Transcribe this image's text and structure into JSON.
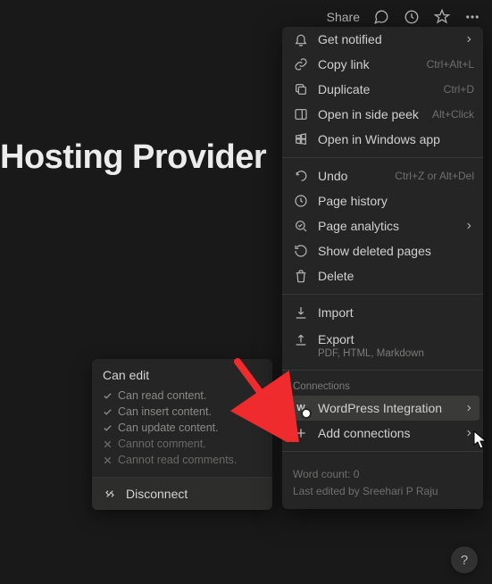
{
  "topbar": {
    "share_label": "Share"
  },
  "page": {
    "title": "Hosting Provider"
  },
  "permissions": {
    "header": "Can edit",
    "items": [
      {
        "label": "Can read content.",
        "allowed": true
      },
      {
        "label": "Can insert content.",
        "allowed": true
      },
      {
        "label": "Can update content.",
        "allowed": true
      },
      {
        "label": "Cannot comment.",
        "allowed": false
      },
      {
        "label": "Cannot read comments.",
        "allowed": false
      }
    ],
    "disconnect_label": "Disconnect"
  },
  "menu": {
    "items": [
      {
        "icon": "bell",
        "label": "Get notified",
        "chevron": true
      },
      {
        "icon": "link",
        "label": "Copy link",
        "shortcut": "Ctrl+Alt+L"
      },
      {
        "icon": "duplicate",
        "label": "Duplicate",
        "shortcut": "Ctrl+D"
      },
      {
        "icon": "sidepeek",
        "label": "Open in side peek",
        "shortcut": "Alt+Click"
      },
      {
        "icon": "windows",
        "label": "Open in Windows app"
      }
    ],
    "items2": [
      {
        "icon": "undo",
        "label": "Undo",
        "shortcut": "Ctrl+Z or Alt+Del"
      },
      {
        "icon": "history",
        "label": "Page history"
      },
      {
        "icon": "analytics",
        "label": "Page analytics",
        "chevron": true
      },
      {
        "icon": "restore",
        "label": "Show deleted pages"
      },
      {
        "icon": "trash",
        "label": "Delete"
      }
    ],
    "items3": [
      {
        "icon": "import",
        "label": "Import"
      },
      {
        "icon": "export",
        "label": "Export",
        "sub": "PDF, HTML, Markdown"
      }
    ],
    "connections_header": "Connections",
    "connections": [
      {
        "icon": "wp",
        "label": "WordPress Integration",
        "chevron": true,
        "hover": true
      },
      {
        "icon": "plus",
        "label": "Add connections",
        "chevron": true
      }
    ],
    "footer": {
      "word_count": "Word count: 0",
      "last_edited": "Last edited by Sreehari P Raju"
    }
  },
  "help": "?"
}
